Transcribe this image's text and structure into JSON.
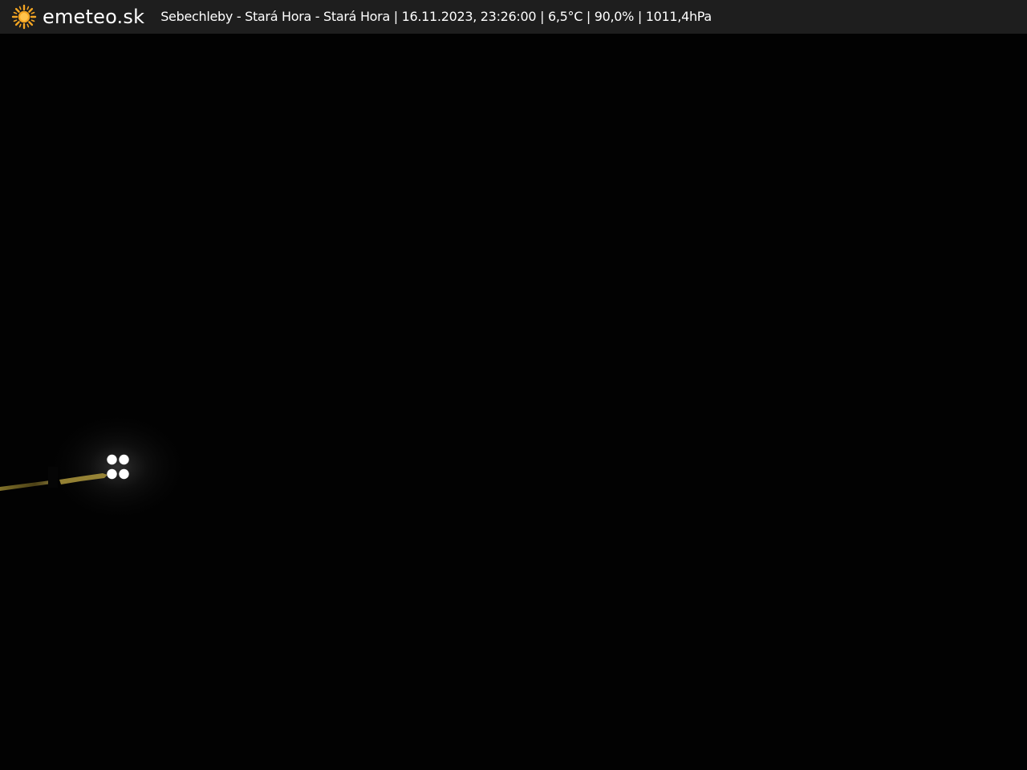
{
  "brand": {
    "name": "emeteo.sk",
    "icon": "sun-icon",
    "icon_color": "#f5a623"
  },
  "caption": {
    "location": "Sebechleby - Stará Hora - Stará Hora",
    "datetime": "16.11.2023, 23:26:00",
    "temperature": "6,5°C",
    "humidity": "90,0%",
    "pressure": "1011,4hPa",
    "separator": " | "
  },
  "colors": {
    "bar_background": "#1e1e1e",
    "scene_background": "#020202",
    "light_color": "#ffffff",
    "road_glow": "#c8b040"
  }
}
